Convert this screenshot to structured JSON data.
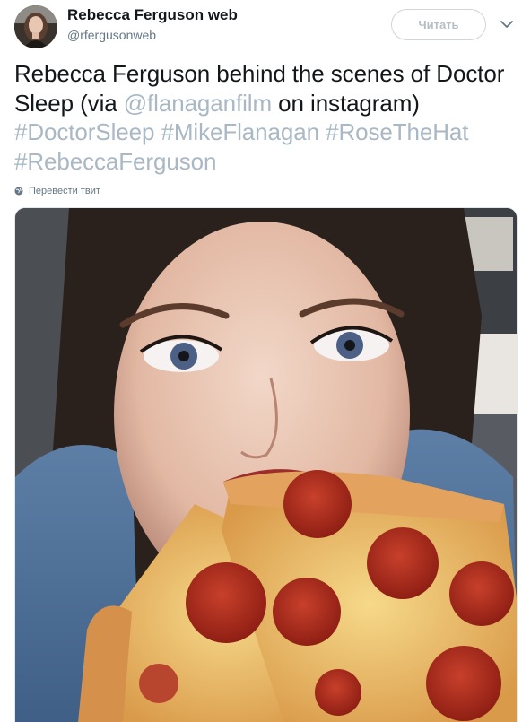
{
  "account": {
    "display_name": "Rebecca Ferguson web",
    "handle": "@rferguson​web"
  },
  "follow_button": {
    "label": "Читать"
  },
  "tweet": {
    "text_plain_1": "Rebecca Ferguson behind the scenes of Doctor Sleep (via ",
    "mention": "@flanaganfilm",
    "text_plain_2": " on instagram) ",
    "hashtag_1": "#DoctorSleep",
    "hashtag_2": "#MikeFlanagan",
    "hashtag_3": "#RoseTheHat",
    "hashtag_4": "#RebeccaFerguson"
  },
  "translate_link": {
    "label": "Перевести твит"
  },
  "icons": {
    "chevron": "chevron-down-icon",
    "globe": "globe-icon"
  },
  "colors": {
    "link": "#a9b8c4",
    "text": "#14171a",
    "secondary": "#657786",
    "button_border": "#d0d5d9",
    "button_text": "#b6bec5"
  }
}
